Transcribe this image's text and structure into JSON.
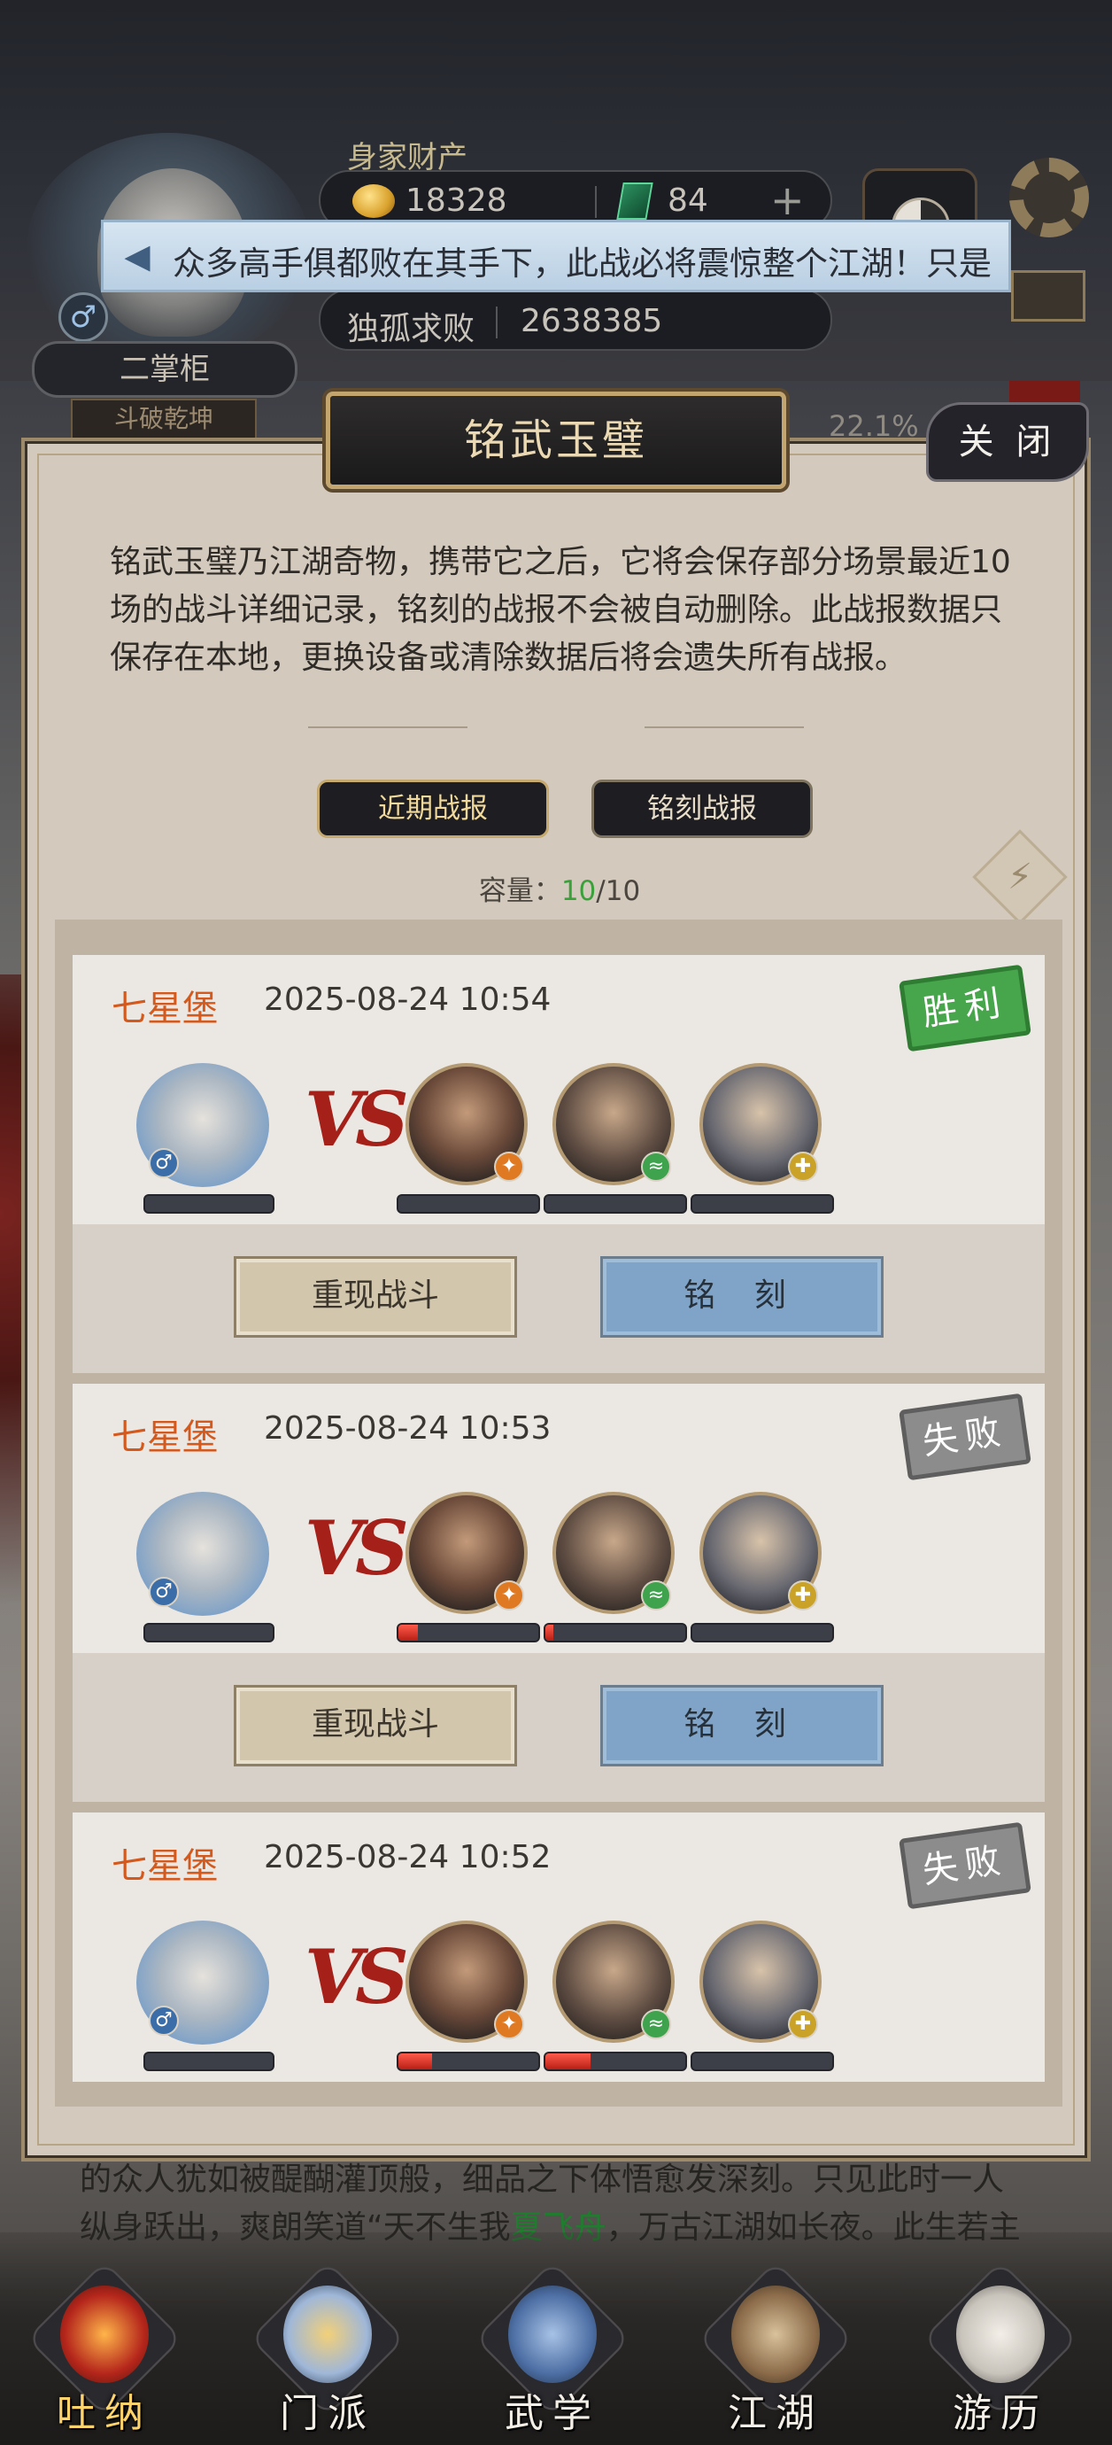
{
  "header": {
    "wealth_label": "身家财产",
    "coins": "18328",
    "jade": "84",
    "plus": "+",
    "rank": "二掌柜",
    "rank_sub": "斗破乾坤",
    "title_name": "独孤求败",
    "power": "2638385",
    "gender_symbol": "♂",
    "percent_hint": "22.1%"
  },
  "notice": {
    "icon": "megaphone-icon",
    "text": "众多高手俱都败在其手下，此战必将震惊整个江湖！只是"
  },
  "modal": {
    "title": "铭武玉璧",
    "close_label": "关 闭",
    "description": "铭武玉璧乃江湖奇物，携带它之后，它将会保存部分场景最近10场的战斗详细记录，铭刻的战报不会被自动删除。此战报数据只保存在本地，更换设备或清除数据后将会遗失所有战报。",
    "tabs": [
      {
        "label": "近期战报",
        "active": true
      },
      {
        "label": "铭刻战报",
        "active": false
      }
    ],
    "capacity_label": "容量：",
    "capacity_used": "10",
    "capacity_total": "/10",
    "swap_icon": "⚡"
  },
  "records": [
    {
      "location": "七星堡",
      "time": "2025-08-24 10:54",
      "result": "胜利",
      "result_type": "win",
      "enemy_hp": [
        0,
        0,
        0
      ],
      "replay_label": "重现战斗",
      "engrave_label": "铭 刻"
    },
    {
      "location": "七星堡",
      "time": "2025-08-24 10:53",
      "result": "失败",
      "result_type": "lose",
      "enemy_hp": [
        0.14,
        0.06,
        0
      ],
      "replay_label": "重现战斗",
      "engrave_label": "铭 刻"
    },
    {
      "location": "七星堡",
      "time": "2025-08-24 10:52",
      "result": "失败",
      "result_type": "lose",
      "enemy_hp": [
        0.24,
        0.32,
        0
      ]
    }
  ],
  "vs_label": "VS",
  "story": {
    "line1": "的众人犹如被醍醐灌顶般，细品之下体悟愈发深刻。只见此时一人",
    "line2_a": "纵身跃出，爽朗笑道“天不生我",
    "line2_name": "夏飞舟",
    "line2_b": "，万古江湖如长夜。此生若主"
  },
  "nav": [
    {
      "label": "吐纳",
      "active": true,
      "color": "#b5261b"
    },
    {
      "label": "门派",
      "active": false,
      "color": "#d8a74a"
    },
    {
      "label": "武学",
      "active": false,
      "color": "#5a7fb0"
    },
    {
      "label": "江湖",
      "active": false,
      "color": "#8c6c4a"
    },
    {
      "label": "游历",
      "active": false,
      "color": "#c8c4bc"
    }
  ],
  "colors": {
    "accent_location": "#d4591d",
    "win": "#47a54c",
    "lose": "#8c8c8c",
    "engrave_button": "#7fa4c8"
  }
}
